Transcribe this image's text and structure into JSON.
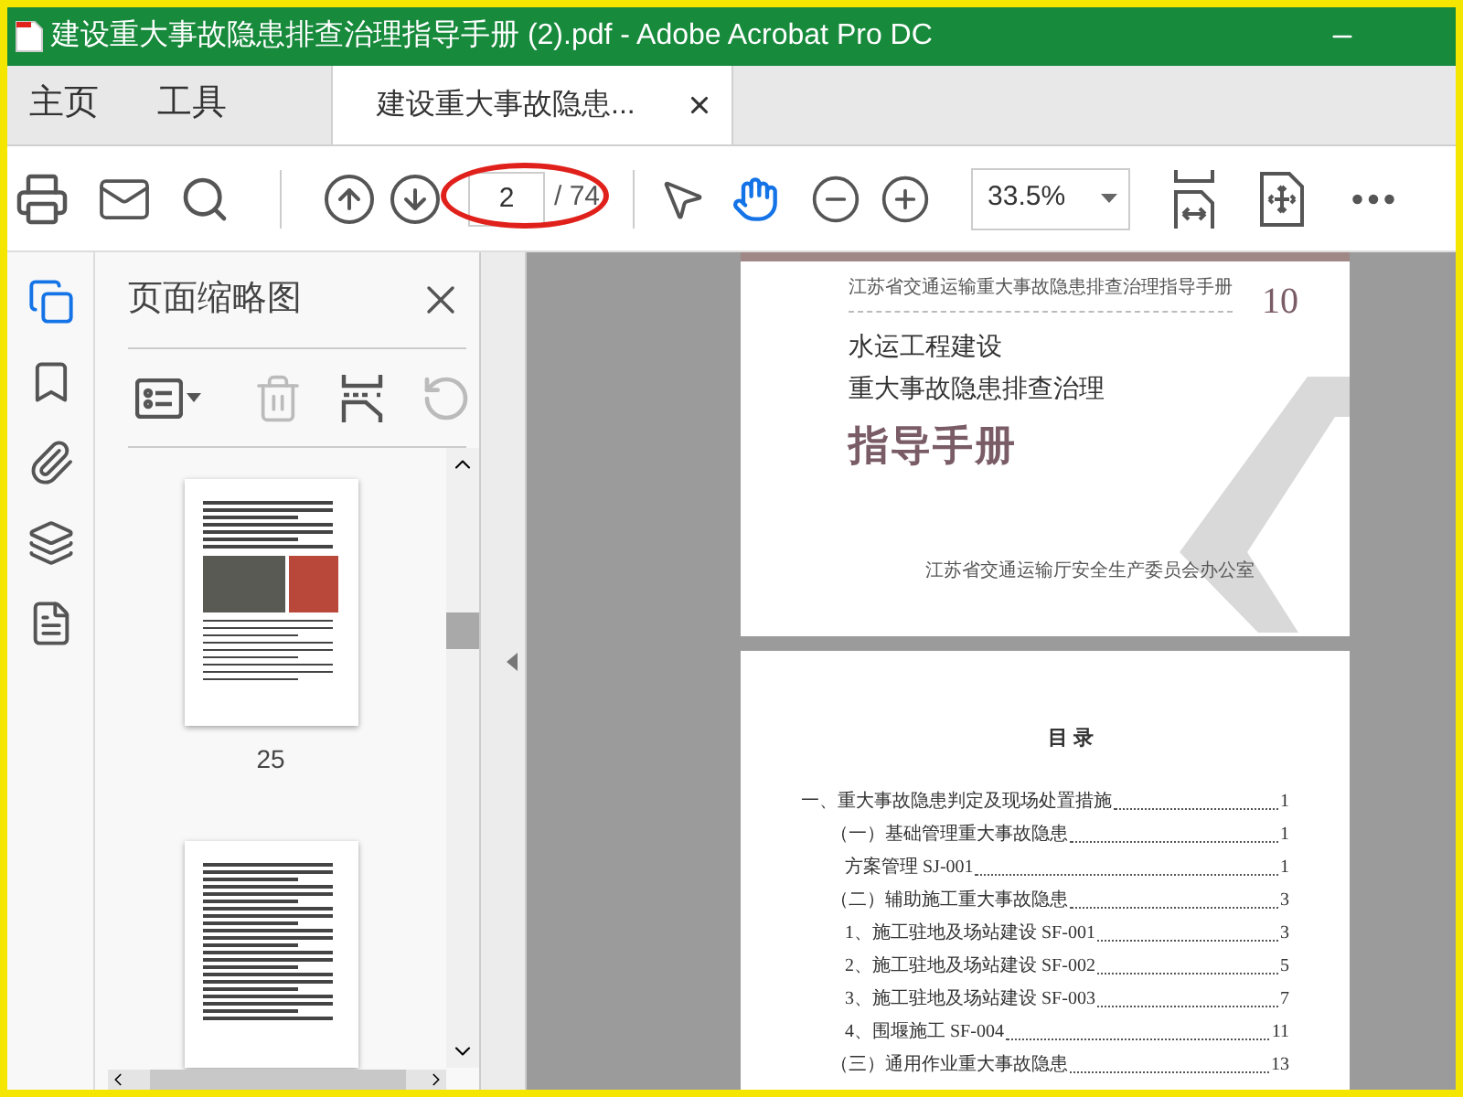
{
  "window": {
    "title": "建设重大事故隐患排查治理指导手册 (2).pdf - Adobe Acrobat Pro DC"
  },
  "tabs": [
    {
      "label": "主页",
      "selected": false
    },
    {
      "label": "工具",
      "selected": false
    },
    {
      "label": "建设重大事故隐患...",
      "selected": true
    }
  ],
  "toolbar": {
    "page_field": {
      "value": "2",
      "total": "/ 74",
      "annotated": true
    },
    "tools": [
      {
        "kind": "select",
        "selected": false
      },
      {
        "kind": "hand",
        "selected": true
      }
    ],
    "zoom": {
      "value": "33.5%"
    }
  },
  "side_rail": [
    {
      "kind": "pages",
      "selected": true
    },
    {
      "kind": "bookmarks",
      "selected": false
    },
    {
      "kind": "attachments",
      "selected": false
    },
    {
      "kind": "layers",
      "selected": false
    },
    {
      "kind": "document",
      "selected": false
    }
  ],
  "thumbnails_panel": {
    "title": "页面缩略图",
    "tools": [
      {
        "kind": "options",
        "disabled": false
      },
      {
        "kind": "delete",
        "disabled": true
      },
      {
        "kind": "extract",
        "disabled": false
      },
      {
        "kind": "rotate",
        "disabled": true
      }
    ],
    "thumbnails": [
      {
        "kind": "photos",
        "label": "25"
      },
      {
        "kind": "text"
      }
    ]
  },
  "cover_page": {
    "header": "江苏省交通运输重大事故隐患排查治理指导手册",
    "number": "10",
    "title_lines": [
      "水运工程建设",
      "重大事故隐患排查治理"
    ],
    "main_title": "指导手册",
    "publisher": "江苏省交通运输厅安全生产委员会办公室"
  },
  "toc_page": {
    "heading": "目 录",
    "entries": [
      {
        "text": "一、重大事故隐患判定及现场处置措施",
        "page": "1",
        "children": [
          {
            "text": "（一）基础管理重大事故隐患",
            "page": "1",
            "children": [
              {
                "text": "方案管理 SJ-001",
                "page": "1"
              }
            ]
          },
          {
            "text": "（二）辅助施工重大事故隐患",
            "page": "3",
            "children": [
              {
                "text": "1、施工驻地及场站建设 SF-001",
                "page": "3"
              },
              {
                "text": "2、施工驻地及场站建设 SF-002",
                "page": "5"
              },
              {
                "text": "3、施工驻地及场站建设 SF-003",
                "page": "7"
              },
              {
                "text": "4、围堰施工 SF-004",
                "page": "11"
              }
            ]
          },
          {
            "text": "（三）通用作业重大事故隐患",
            "page": "13"
          }
        ]
      }
    ]
  }
}
